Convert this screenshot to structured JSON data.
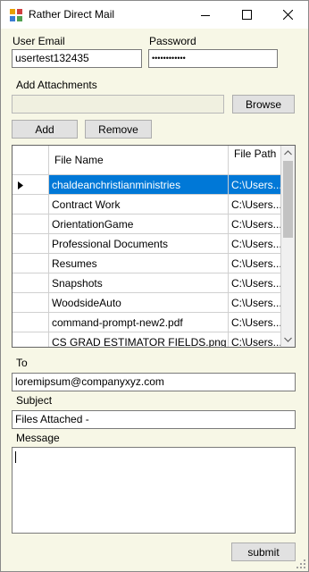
{
  "window": {
    "title": "Rather Direct Mail"
  },
  "form": {
    "user_email_label": "User Email",
    "user_email_value": "usertest132435",
    "password_label": "Password",
    "password_value": "••••••••••••",
    "add_attachments_label": "Add Attachments",
    "attachment_path_value": "",
    "browse_label": "Browse",
    "add_label": "Add",
    "remove_label": "Remove",
    "to_label": "To",
    "to_value": "loremipsum@companyxyz.com",
    "subject_label": "Subject",
    "subject_value": "Files Attached -",
    "message_label": "Message",
    "message_value": "",
    "submit_label": "submit"
  },
  "grid": {
    "columns": {
      "name": "File Name",
      "path": "File Path"
    },
    "rows": [
      {
        "name": "chaldeanchristianministries",
        "path": "C:\\Users..."
      },
      {
        "name": "Contract Work",
        "path": "C:\\Users..."
      },
      {
        "name": "OrientationGame",
        "path": "C:\\Users..."
      },
      {
        "name": "Professional Documents",
        "path": "C:\\Users..."
      },
      {
        "name": "Resumes",
        "path": "C:\\Users..."
      },
      {
        "name": "Snapshots",
        "path": "C:\\Users..."
      },
      {
        "name": "WoodsideAuto",
        "path": "C:\\Users..."
      },
      {
        "name": "command-prompt-new2.pdf",
        "path": "C:\\Users..."
      },
      {
        "name": "CS GRAD ESTIMATOR FIELDS.png",
        "path": "C:\\Users..."
      }
    ],
    "selected_row": 0
  },
  "colors": {
    "accent": "#0078d7",
    "form_bg": "#f7f7e6"
  }
}
